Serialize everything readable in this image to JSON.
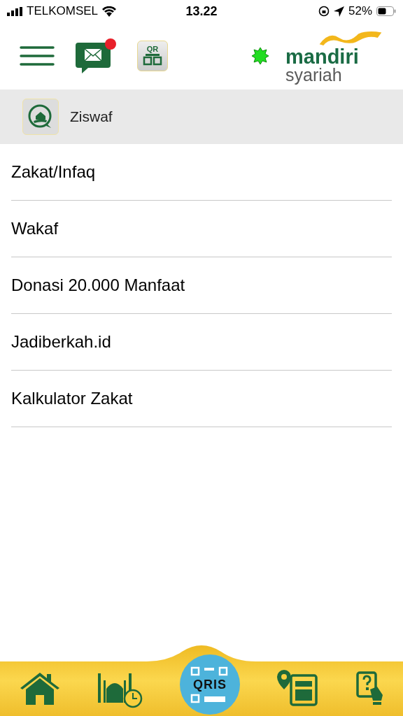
{
  "status_bar": {
    "carrier": "TELKOMSEL",
    "time": "13.22",
    "battery": "52%"
  },
  "header": {
    "unread_messages": true,
    "qr_label": "QR",
    "logo_top": "mandiri",
    "logo_bottom": "syariah"
  },
  "section": {
    "title": "Ziswaf"
  },
  "menu": [
    {
      "label": "Zakat/Infaq"
    },
    {
      "label": "Wakaf"
    },
    {
      "label": "Donasi 20.000 Manfaat"
    },
    {
      "label": "Jadiberkah.id"
    },
    {
      "label": "Kalkulator Zakat"
    }
  ],
  "bottom_nav": {
    "qris_label": "QRIS"
  }
}
